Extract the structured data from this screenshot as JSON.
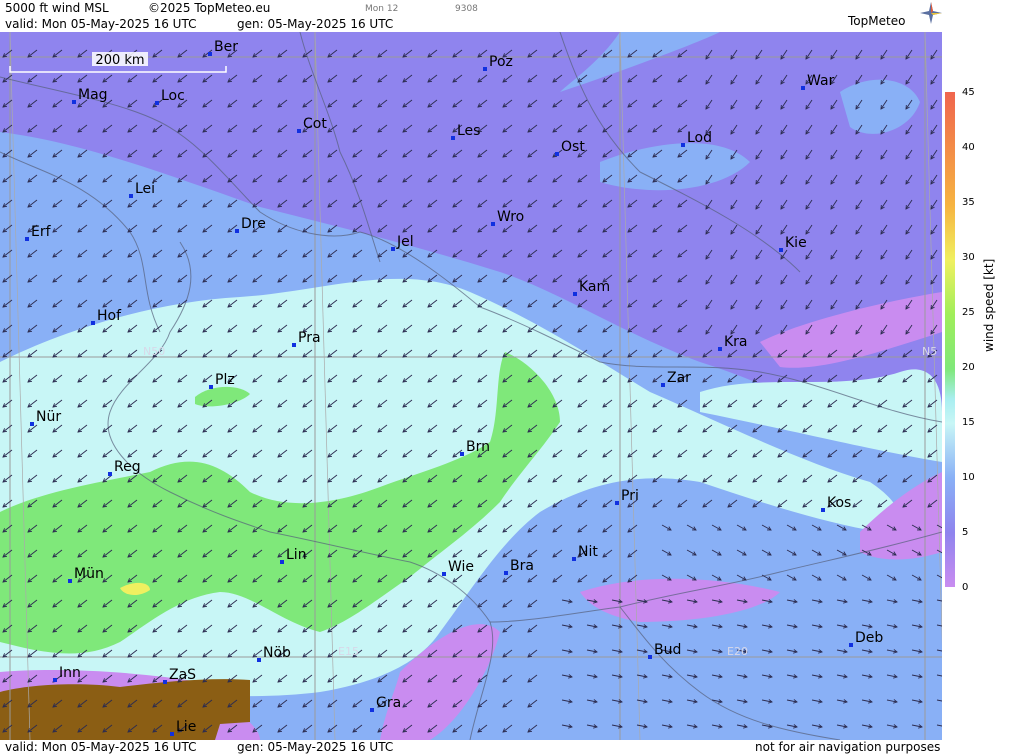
{
  "header": {
    "product": "5000 ft wind MSL",
    "copyright": "©2025 TopMeteo.eu",
    "run_small": "Mon 12",
    "code_small": "9308",
    "valid": "valid:  Mon  05-May-2025  16 UTC",
    "gen": "gen: 05-May-2025 16 UTC"
  },
  "brand": {
    "name": "TopMeteo",
    "logo_icon": "compass-star-icon"
  },
  "scale_bar": {
    "label": "200 km"
  },
  "grid_labels": [
    {
      "id": "n50",
      "text": "N50"
    },
    {
      "id": "n5",
      "text": "N5"
    },
    {
      "id": "e15",
      "text": "E15"
    },
    {
      "id": "e20",
      "text": "E20"
    }
  ],
  "cities": [
    {
      "name": "Ber"
    },
    {
      "name": "Poz"
    },
    {
      "name": "Mag"
    },
    {
      "name": "Loc"
    },
    {
      "name": "War"
    },
    {
      "name": "Cot"
    },
    {
      "name": "Les"
    },
    {
      "name": "Lod"
    },
    {
      "name": "Ost"
    },
    {
      "name": "Lei"
    },
    {
      "name": "Wro"
    },
    {
      "name": "Dre"
    },
    {
      "name": "Erf"
    },
    {
      "name": "Jel"
    },
    {
      "name": "Kie"
    },
    {
      "name": "Kam"
    },
    {
      "name": "Hof"
    },
    {
      "name": "Pra"
    },
    {
      "name": "Kra"
    },
    {
      "name": "Zar"
    },
    {
      "name": "Plz"
    },
    {
      "name": "Nür"
    },
    {
      "name": "Brn"
    },
    {
      "name": "Reg"
    },
    {
      "name": "Pri"
    },
    {
      "name": "Kos"
    },
    {
      "name": "Lin"
    },
    {
      "name": "Nit"
    },
    {
      "name": "Wie"
    },
    {
      "name": "Bra"
    },
    {
      "name": "Mün"
    },
    {
      "name": "Deb"
    },
    {
      "name": "Bud"
    },
    {
      "name": "Nöb"
    },
    {
      "name": "ZaS"
    },
    {
      "name": "Inn"
    },
    {
      "name": "Gra"
    },
    {
      "name": "Lie"
    }
  ],
  "legend": {
    "unit_label": "wind  speed  [kt]",
    "ticks": [
      "45",
      "40",
      "35",
      "30",
      "25",
      "20",
      "15",
      "10",
      "5",
      "0"
    ],
    "colors": {
      "0": "#c98cf0",
      "5": "#8f84ee",
      "10": "#89b0f6",
      "15": "#c8f6f6",
      "20": "#7fe87a",
      "30": "#f0f060",
      "35": "#f6b441",
      "45": "#f0654e"
    }
  },
  "footer": {
    "valid": "valid:  Mon  05-May-2025  16 UTC",
    "gen": "gen: 05-May-2025 16 UTC",
    "disclaimer": "not for air navigation purposes"
  }
}
